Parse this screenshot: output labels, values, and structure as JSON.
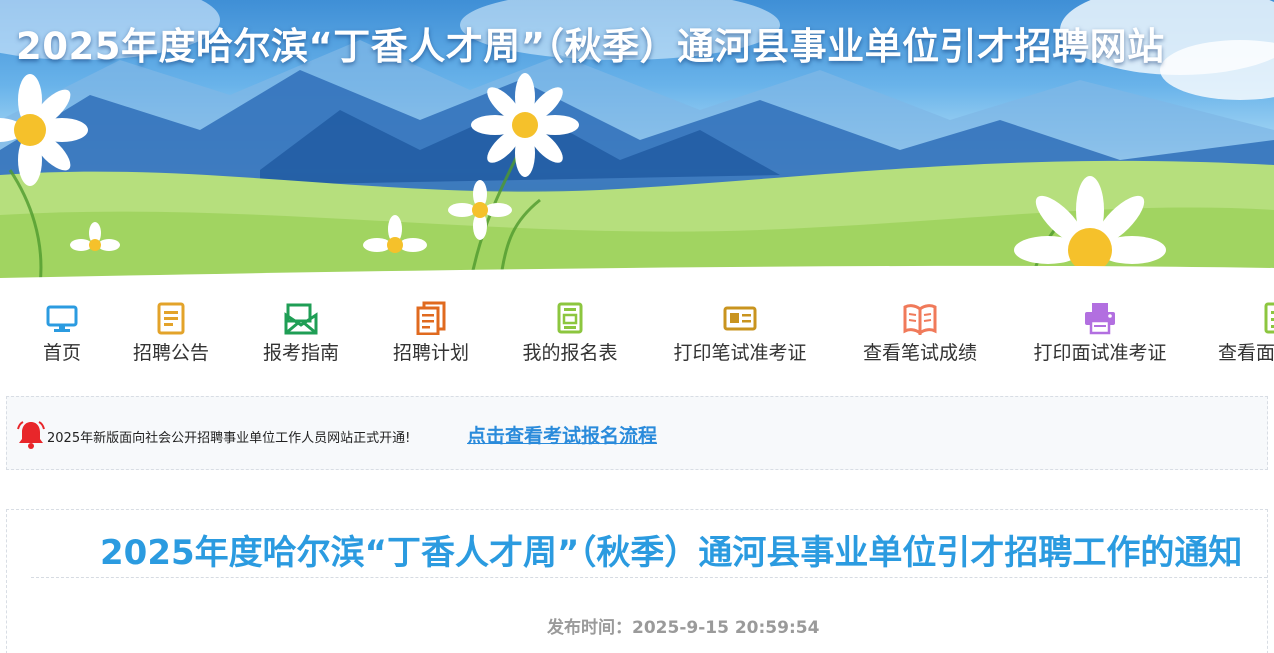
{
  "site": {
    "banner_title": "2025年度哈尔滨“丁香人才周”（秋季）通河县事业单位引才招聘网站"
  },
  "nav": {
    "items": [
      {
        "label": "首页",
        "icon": "monitor-icon",
        "color": "#2b9be0"
      },
      {
        "label": "招聘公告",
        "icon": "document-icon",
        "color": "#e3a32a"
      },
      {
        "label": "报考指南",
        "icon": "envelope-icon",
        "color": "#1f9e55"
      },
      {
        "label": "招聘计划",
        "icon": "documents-icon",
        "color": "#e06a1f"
      },
      {
        "label": "我的报名表",
        "icon": "form-icon",
        "color": "#8cc63f"
      },
      {
        "label": "打印笔试准考证",
        "icon": "id-card-icon",
        "color": "#c9941f"
      },
      {
        "label": "查看笔试成绩",
        "icon": "open-book-icon",
        "color": "#f07a5a"
      },
      {
        "label": "打印面试准考证",
        "icon": "printer-icon",
        "color": "#b26fe0"
      },
      {
        "label": "查看面",
        "icon": "list-icon",
        "color": "#8cc63f"
      }
    ]
  },
  "notice": {
    "text": "2025年新版面向社会公开招聘事业单位工作人员网站正式开通!",
    "link": "点击查看考试报名流程",
    "icon": "bell-icon",
    "icon_color": "#e8262a"
  },
  "article": {
    "title": "2025年度哈尔滨“丁香人才周”（秋季）通河县事业单位引才招聘工作的通知",
    "publish_label": "发布时间：",
    "publish_time": "2025-9-15 20:59:54"
  },
  "colors": {
    "accent": "#2b9be0",
    "link": "#2a8bdb"
  }
}
